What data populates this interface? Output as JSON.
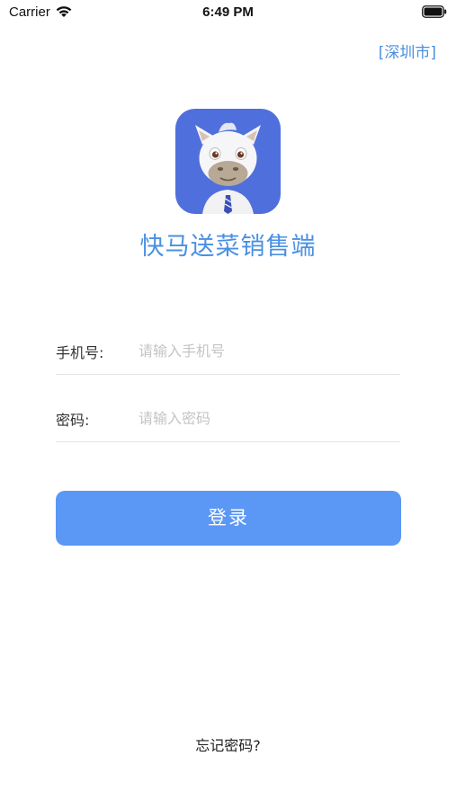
{
  "status_bar": {
    "carrier": "Carrier",
    "time": "6:49 PM"
  },
  "city": {
    "label": "[深圳市]"
  },
  "app": {
    "title": "快马送菜销售端",
    "logo_color": "#4f6fdc"
  },
  "form": {
    "phone_label": "手机号:",
    "phone_placeholder": "请输入手机号",
    "phone_value": "",
    "password_label": "密码:",
    "password_placeholder": "请输入密码",
    "password_value": ""
  },
  "actions": {
    "login_label": "登录",
    "forgot_label": "忘记密码?"
  },
  "colors": {
    "accent": "#4a90e2",
    "button": "#5b97f5"
  }
}
